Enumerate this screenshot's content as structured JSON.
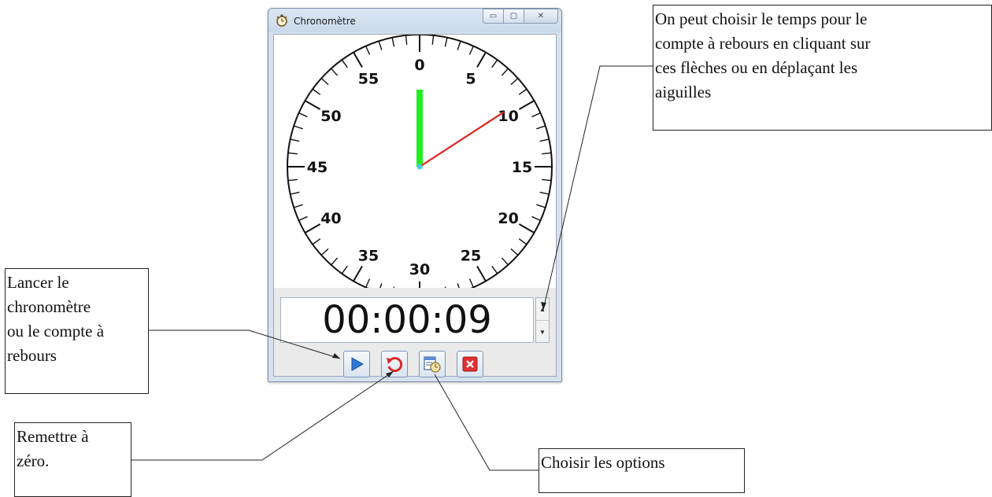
{
  "window": {
    "title": "Chronomètre",
    "minimize_glyph": "▭",
    "maximize_glyph": "▢",
    "close_glyph": "✕"
  },
  "dial": {
    "labels": [
      "0",
      "5",
      "10",
      "15",
      "20",
      "25",
      "30",
      "35",
      "40",
      "45",
      "50",
      "55"
    ],
    "minutes_hand_value": 0,
    "seconds_hand_value": 9.5,
    "minute_hand_color": "#22ee22",
    "second_hand_color": "#e02020",
    "center_color": "#3fd0e0"
  },
  "display": {
    "time": "00:00:09",
    "spinner_up": "▲",
    "spinner_down": "▼"
  },
  "toolbar": {
    "start_icon": "play-icon",
    "reset_icon": "reset-icon",
    "options_icon": "options-icon",
    "close_icon": "close-icon",
    "accent": "#2f78d6",
    "danger": "#e03030"
  },
  "callouts": {
    "top_right": "On peut choisir le temps pour le\ncompte à rebours en cliquant sur\nces flèches ou en déplaçant les\naiguilles",
    "start": "Lancer le\nchronomètre\nou le compte à\nrebours",
    "reset": "Remettre à\nzéro.",
    "options": "Choisir les options"
  }
}
